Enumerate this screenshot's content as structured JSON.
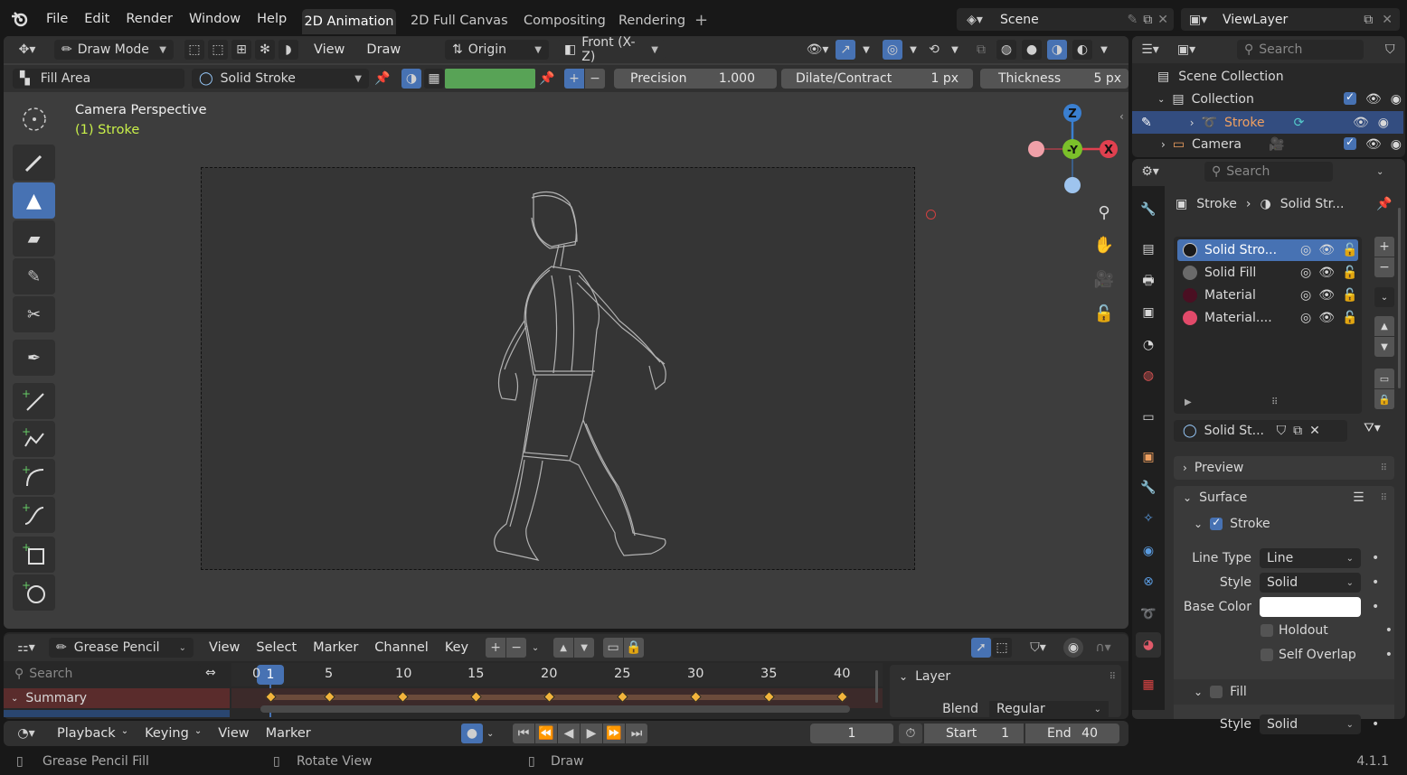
{
  "topbar": {
    "menus": [
      "File",
      "Edit",
      "Render",
      "Window",
      "Help"
    ],
    "workspaces": [
      "2D Animation",
      "2D Full Canvas",
      "Compositing",
      "Rendering"
    ],
    "active_workspace": "2D Animation",
    "add_tab": "+",
    "scene": "Scene",
    "view_layer": "ViewLayer"
  },
  "header": {
    "mode": "Draw Mode",
    "menus": [
      "View",
      "Draw"
    ],
    "origin": "Origin",
    "orientation": "Front (X-Z)"
  },
  "toolsettings": {
    "tool": "Fill Area",
    "material": "Solid Stroke",
    "precision_label": "Precision",
    "precision_value": "1.000",
    "dilate_label": "Dilate/Contract",
    "dilate_value": "1 px",
    "thickness_label": "Thickness",
    "thickness_value": "5 px",
    "plus": "+",
    "minus": "−"
  },
  "viewport": {
    "title": "Camera Perspective",
    "object": "(1) Stroke",
    "gizmo": {
      "z": "Z",
      "y": "-Y",
      "x": "X"
    }
  },
  "outliner": {
    "search_placeholder": "Search",
    "root": "Scene Collection",
    "items": [
      {
        "name": "Collection"
      },
      {
        "name": "Stroke"
      },
      {
        "name": "Camera"
      }
    ]
  },
  "properties": {
    "search_placeholder": "Search",
    "breadcrumb": [
      "Stroke",
      "Solid Str..."
    ],
    "materials": [
      "Solid Stro...",
      "Solid Fill",
      "Material",
      "Material...."
    ],
    "material_colors": [
      "#1a1a1a",
      "#6a6a6a",
      "#4a0f22",
      "#e24a6a"
    ],
    "slot_name": "Solid St...",
    "sections": {
      "preview": "Preview",
      "surface": "Surface",
      "stroke": "Stroke",
      "fill": "Fill"
    },
    "stroke_props": {
      "line_type_label": "Line Type",
      "line_type": "Line",
      "style_label": "Style",
      "style": "Solid",
      "base_color_label": "Base Color",
      "holdout": "Holdout",
      "self_overlap": "Self Overlap"
    },
    "fill_props": {
      "style_label": "Style",
      "style": "Solid"
    }
  },
  "dopesheet": {
    "mode": "Grease Pencil",
    "menus": [
      "View",
      "Select",
      "Marker",
      "Channel",
      "Key"
    ],
    "search_placeholder": "Search",
    "summary": "Summary",
    "current_frame": "1",
    "ticks": [
      "0",
      "5",
      "10",
      "15",
      "20",
      "25",
      "30",
      "35",
      "40"
    ],
    "keyframes": [
      1,
      5,
      10,
      15,
      20,
      25,
      30,
      35,
      40
    ],
    "layer_panel": {
      "title": "Layer",
      "blend_label": "Blend",
      "blend": "Regular"
    }
  },
  "timeline": {
    "menus": [
      "Playback",
      "Keying",
      "View",
      "Marker"
    ],
    "frame": "1",
    "start_label": "Start",
    "start": "1",
    "end_label": "End",
    "end": "40"
  },
  "statusbar": {
    "left": "Grease Pencil Fill",
    "middle": "Rotate View",
    "right": "Draw",
    "version": "4.1.1"
  }
}
